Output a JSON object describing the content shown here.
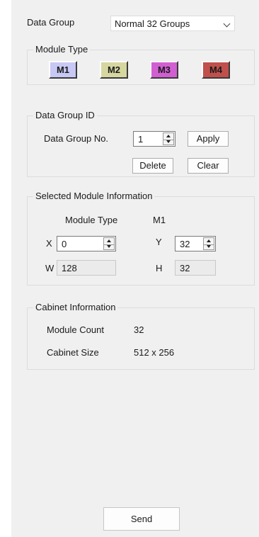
{
  "data_group": {
    "label": "Data Group",
    "selected": "Normal 32 Groups"
  },
  "module_type_group": {
    "title": "Module Type",
    "modules": [
      {
        "label": "M1",
        "color": "#c8c8f4"
      },
      {
        "label": "M2",
        "color": "#d6d6a0"
      },
      {
        "label": "M3",
        "color": "#d25fd2"
      },
      {
        "label": "M4",
        "color": "#c0504c"
      }
    ]
  },
  "data_group_id": {
    "title": "Data Group ID",
    "number_label": "Data Group No.",
    "number_value": "1",
    "apply_label": "Apply",
    "delete_label": "Delete",
    "clear_label": "Clear"
  },
  "selected_module_info": {
    "title": "Selected Module Information",
    "module_type_label": "Module Type",
    "module_type_value": "M1",
    "x_label": "X",
    "x_value": "0",
    "y_label": "Y",
    "y_value": "32",
    "w_label": "W",
    "w_value": "128",
    "h_label": "H",
    "h_value": "32"
  },
  "cabinet_info": {
    "title": "Cabinet Information",
    "module_count_label": "Module Count",
    "module_count_value": "32",
    "cabinet_size_label": "Cabinet Size",
    "cabinet_size_value": "512 x 256"
  },
  "send_label": "Send"
}
